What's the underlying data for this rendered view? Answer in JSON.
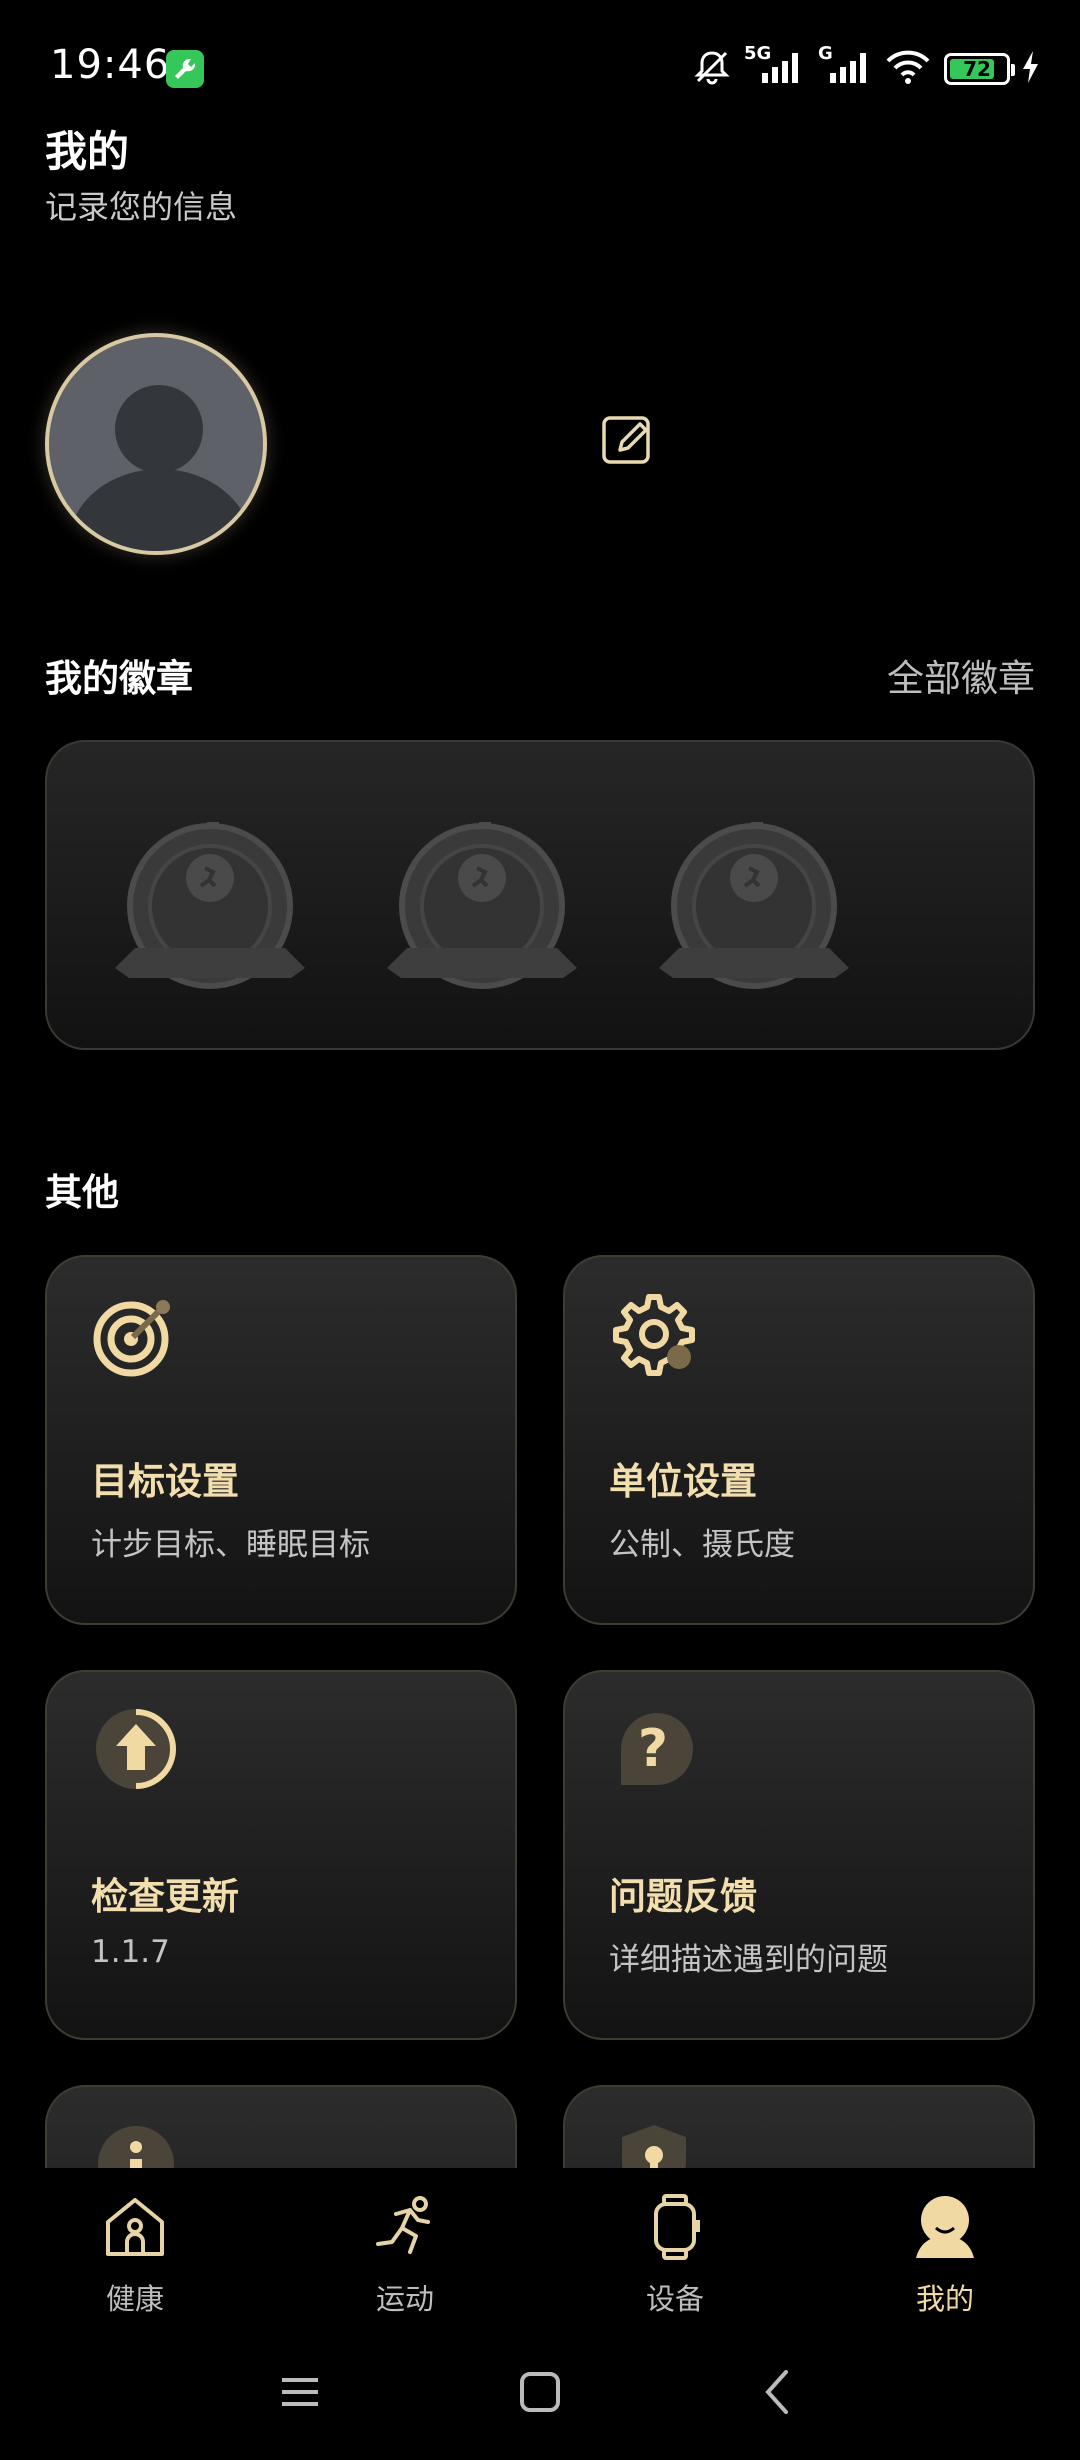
{
  "status_bar": {
    "time": "19:46",
    "battery": "72",
    "network_5g": "5G",
    "network_g": "G"
  },
  "header": {
    "title": "我的",
    "subtitle": "记录您的信息"
  },
  "badges": {
    "title": "我的徽章",
    "all_link": "全部徽章"
  },
  "other": {
    "title": "其他",
    "cards": [
      {
        "title": "目标设置",
        "subtitle": "计步目标、睡眠目标",
        "icon": "target-icon"
      },
      {
        "title": "单位设置",
        "subtitle": "公制、摄氏度",
        "icon": "gear-icon"
      },
      {
        "title": "检查更新",
        "subtitle": "1.1.7",
        "icon": "update-arrow-icon"
      },
      {
        "title": "问题反馈",
        "subtitle": "详细描述遇到的问题",
        "icon": "question-icon"
      }
    ]
  },
  "bottom_nav": [
    {
      "label": "健康",
      "icon": "home-icon"
    },
    {
      "label": "运动",
      "icon": "running-icon"
    },
    {
      "label": "设备",
      "icon": "watch-icon"
    },
    {
      "label": "我的",
      "icon": "profile-icon",
      "active": true
    }
  ],
  "colors": {
    "accent": "#f1d9a3",
    "background": "#000000",
    "battery": "#35c759"
  }
}
